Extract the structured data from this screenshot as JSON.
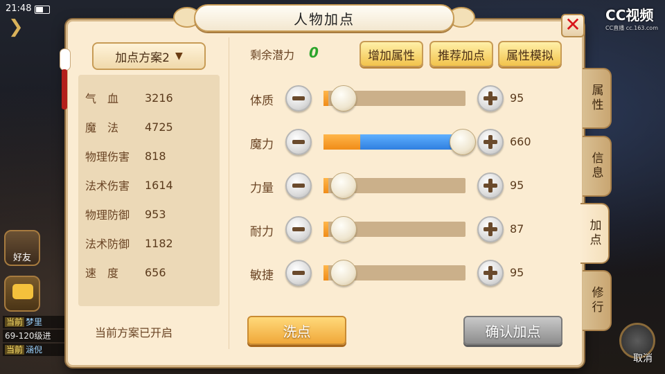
{
  "status": {
    "time": "21:48"
  },
  "watermark": {
    "line1": "CC视频",
    "line2": "CC直播 cc.163.com"
  },
  "background": {
    "friend_label": "好友",
    "chat_lines": [
      {
        "tag": "当前",
        "text": "梦里"
      },
      {
        "tag": "",
        "text": "69-120级进"
      },
      {
        "tag": "当前",
        "text": "涵倪"
      }
    ],
    "cancel_label": "取消"
  },
  "dialog": {
    "title": "人物加点",
    "close_label": "✕",
    "scheme_select": {
      "label": "加点方案2",
      "chevron": "chevron-down-icon"
    },
    "stats": [
      {
        "label": "气　血",
        "value": "3216"
      },
      {
        "label": "魔　法",
        "value": "4725"
      },
      {
        "label": "物理伤害",
        "value": "818"
      },
      {
        "label": "法术伤害",
        "value": "1614"
      },
      {
        "label": "物理防御",
        "value": "953"
      },
      {
        "label": "法术防御",
        "value": "1182"
      },
      {
        "label": "速　度",
        "value": "656"
      }
    ],
    "scheme_status": "当前方案已开启",
    "remaining_label": "剩余潜力",
    "remaining_value": "0",
    "buttons": {
      "add_attr": "增加属性",
      "recommend": "推荐加点",
      "simulate": "属性模拟",
      "wash": "洗点",
      "confirm": "确认加点"
    },
    "attributes": [
      {
        "label": "体质",
        "value": "95",
        "base_fraction": 0.03,
        "level_fraction": 0.03
      },
      {
        "label": "魔力",
        "value": "660",
        "base_fraction": 0.26,
        "level_fraction": 0.98
      },
      {
        "label": "力量",
        "value": "95",
        "base_fraction": 0.03,
        "level_fraction": 0.03
      },
      {
        "label": "耐力",
        "value": "87",
        "base_fraction": 0.03,
        "level_fraction": 0.03
      },
      {
        "label": "敏捷",
        "value": "95",
        "base_fraction": 0.03,
        "level_fraction": 0.03
      }
    ],
    "side_tabs": [
      {
        "label": "属性",
        "active": false
      },
      {
        "label": "信息",
        "active": false
      },
      {
        "label": "加点",
        "active": true
      },
      {
        "label": "修行",
        "active": false
      }
    ],
    "colors": {
      "panel_bg": "#fbecd2",
      "base_fill": "#f08c18",
      "added_fill": "#2f7fe0",
      "remaining_value": "#2ca52c",
      "close_x": "#d8141b"
    }
  }
}
